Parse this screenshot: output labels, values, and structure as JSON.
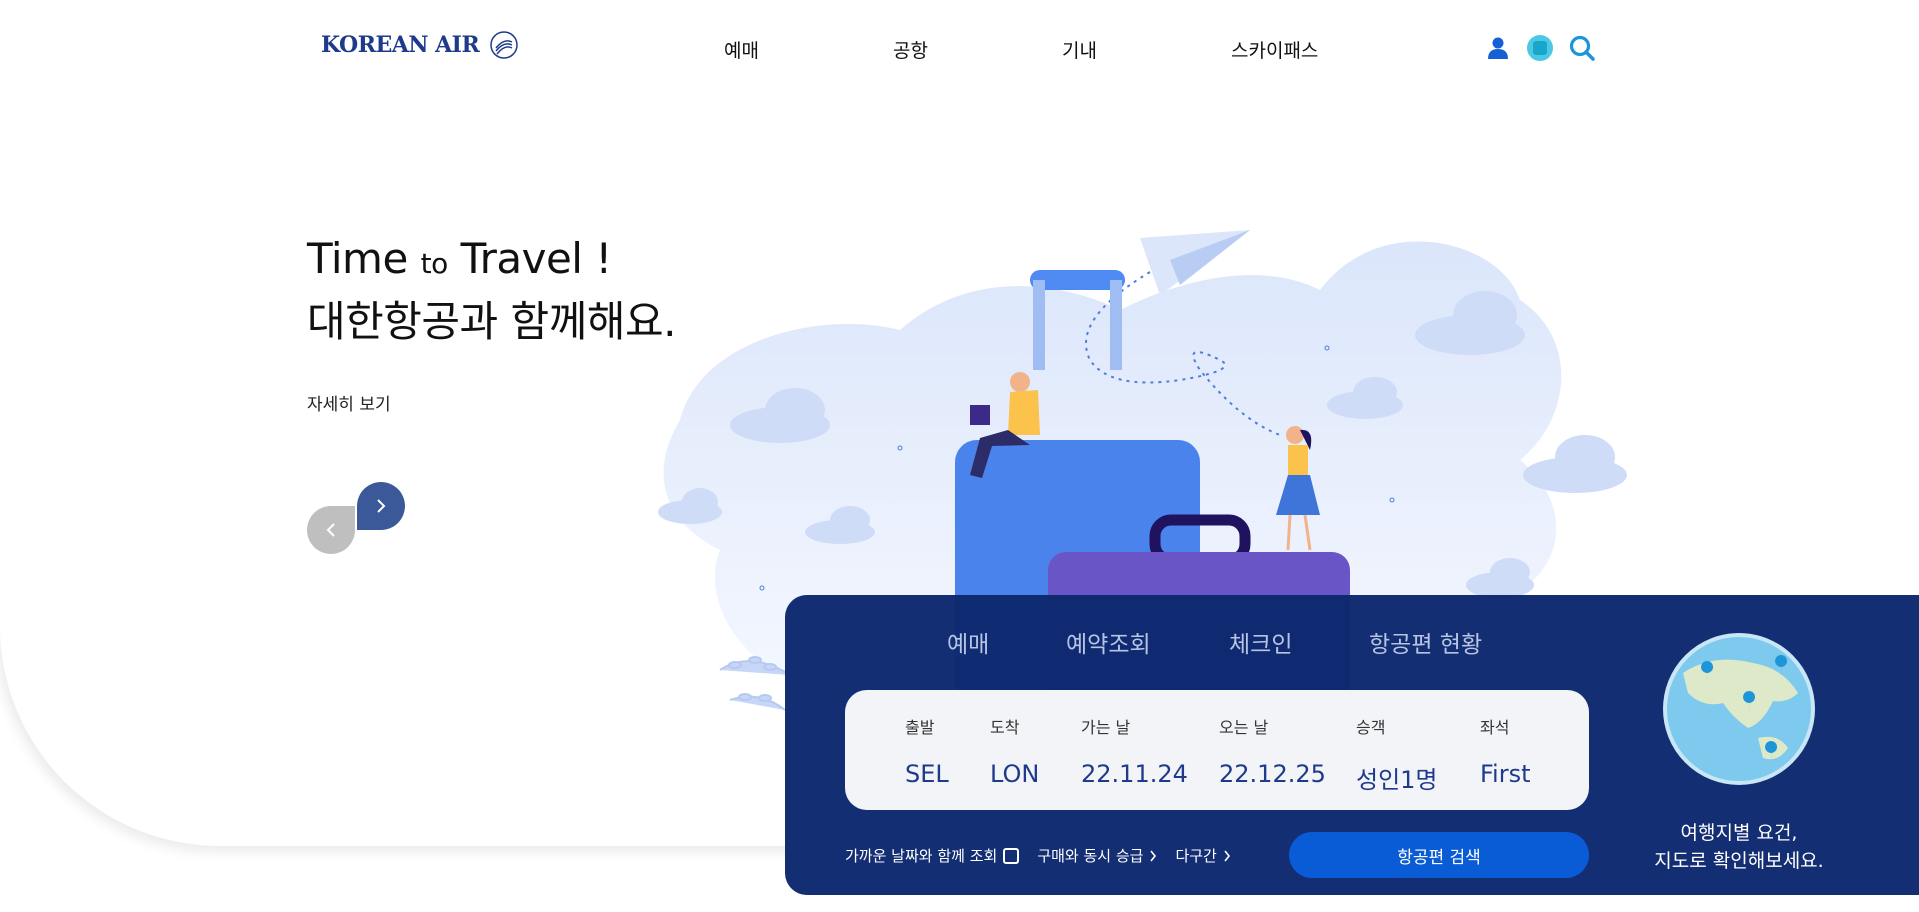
{
  "header": {
    "logo_text": "KOREAN AIR",
    "nav": [
      {
        "label": "예매"
      },
      {
        "label": "공항"
      },
      {
        "label": "기내"
      },
      {
        "label": "스카이패스"
      }
    ],
    "icons": [
      "user-icon",
      "globe-icon",
      "search-icon"
    ]
  },
  "hero": {
    "title_line1_a": "Time",
    "title_line1_b": "to",
    "title_line1_c": "Travel !",
    "title_line2": "대한항공과 함께해요.",
    "link": "자세히 보기",
    "prev_icon": "chevron-left-icon",
    "next_icon": "chevron-right-icon"
  },
  "booking": {
    "tabs": [
      {
        "label": "예매"
      },
      {
        "label": "예약조회"
      },
      {
        "label": "체크인"
      },
      {
        "label": "항공편 현황"
      }
    ],
    "fields": [
      {
        "label": "출발",
        "value": "SEL"
      },
      {
        "label": "도착",
        "value": "LON"
      },
      {
        "label": "가는 날",
        "value": "22.11.24"
      },
      {
        "label": "오는 날",
        "value": "22.12.25"
      },
      {
        "label": "승객",
        "value": "성인1명"
      },
      {
        "label": "좌석",
        "value": "First"
      }
    ],
    "options": {
      "nearby_dates": "가까운 날짜와 함께 조회",
      "upgrade": "구매와 동시 승급",
      "multi_city": "다구간"
    },
    "search_button": "항공편 검색",
    "map_text_line1": "여행지별 요건,",
    "map_text_line2": "지도로 확인해보세요."
  },
  "colors": {
    "brand_navy": "#0e2a70",
    "accent_blue": "#0a5bd6",
    "nav_arrow": "#3b5998"
  }
}
